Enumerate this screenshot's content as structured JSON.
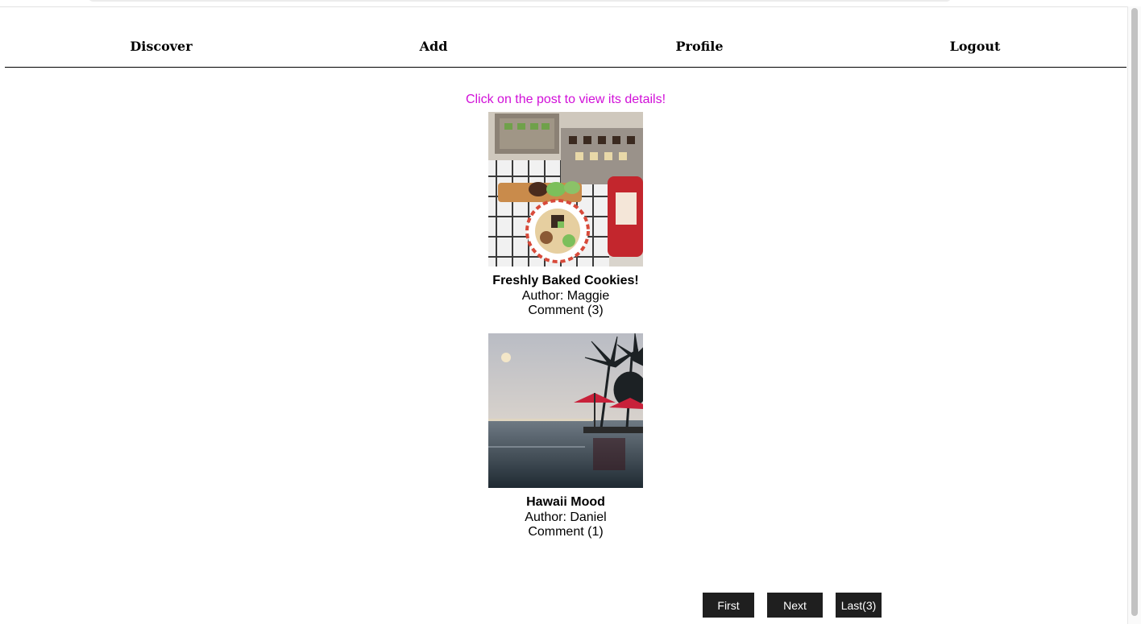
{
  "nav": {
    "discover": "Discover",
    "add": "Add",
    "profile": "Profile",
    "logout": "Logout"
  },
  "hint": "Click on the post to view its details!",
  "posts": [
    {
      "title": "Freshly Baked Cookies!",
      "author": "Author: Maggie",
      "comments": "Comment (3)"
    },
    {
      "title": "Hawaii Mood",
      "author": "Author: Daniel",
      "comments": "Comment (1)"
    }
  ],
  "pager": {
    "first": "First",
    "next": "Next",
    "last": "Last(3)"
  },
  "colors": {
    "hint": "#d10fd8",
    "button_bg": "#1f1f1f"
  }
}
